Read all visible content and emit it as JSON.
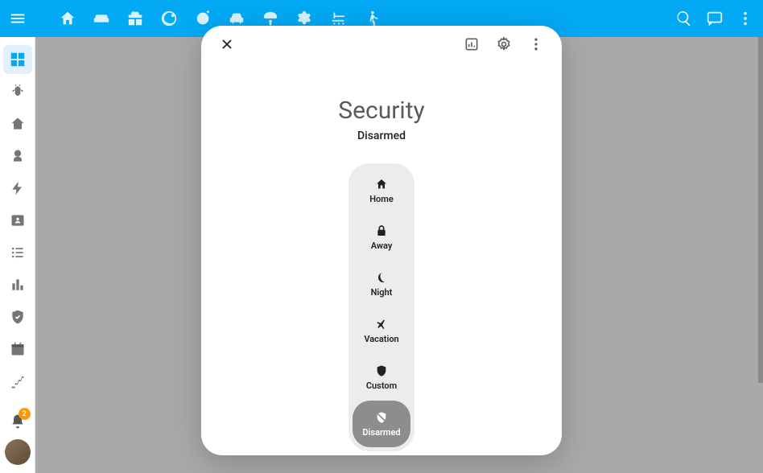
{
  "top_bar": {
    "tabs": [
      "home",
      "sofa",
      "gift",
      "orbit",
      "timer",
      "car",
      "mushroom",
      "flower",
      "shower",
      "walker"
    ]
  },
  "sidebar": {
    "items": [
      "dashboard",
      "bug",
      "home",
      "brain",
      "flash",
      "contact",
      "list",
      "chart",
      "shield",
      "calendar",
      "stairs"
    ],
    "notif_badge": "2"
  },
  "dialog": {
    "title": "Security",
    "status": "Disarmed",
    "modes": [
      {
        "id": "home",
        "label": "Home",
        "icon": "home"
      },
      {
        "id": "away",
        "label": "Away",
        "icon": "lock"
      },
      {
        "id": "night",
        "label": "Night",
        "icon": "moon"
      },
      {
        "id": "vacation",
        "label": "Vacation",
        "icon": "plane"
      },
      {
        "id": "custom",
        "label": "Custom",
        "icon": "shield"
      },
      {
        "id": "disarmed",
        "label": "Disarmed",
        "icon": "shield-off",
        "selected": true
      }
    ]
  }
}
